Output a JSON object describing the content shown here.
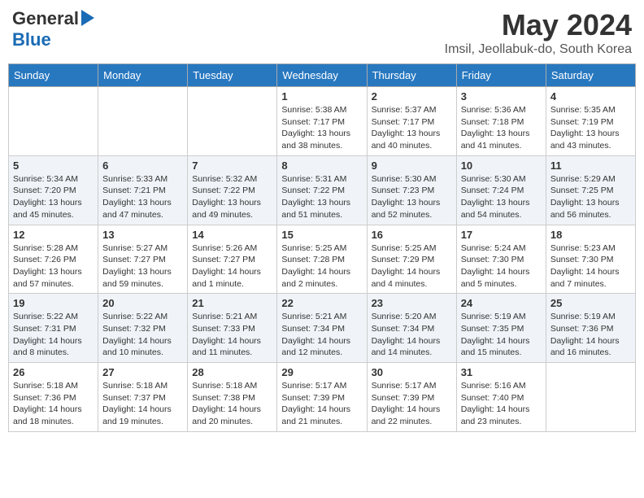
{
  "logo": {
    "general": "General",
    "blue": "Blue"
  },
  "header": {
    "month": "May 2024",
    "location": "Imsil, Jeollabuk-do, South Korea"
  },
  "days_of_week": [
    "Sunday",
    "Monday",
    "Tuesday",
    "Wednesday",
    "Thursday",
    "Friday",
    "Saturday"
  ],
  "weeks": [
    [
      {
        "day": "",
        "info": ""
      },
      {
        "day": "",
        "info": ""
      },
      {
        "day": "",
        "info": ""
      },
      {
        "day": "1",
        "info": "Sunrise: 5:38 AM\nSunset: 7:17 PM\nDaylight: 13 hours\nand 38 minutes."
      },
      {
        "day": "2",
        "info": "Sunrise: 5:37 AM\nSunset: 7:17 PM\nDaylight: 13 hours\nand 40 minutes."
      },
      {
        "day": "3",
        "info": "Sunrise: 5:36 AM\nSunset: 7:18 PM\nDaylight: 13 hours\nand 41 minutes."
      },
      {
        "day": "4",
        "info": "Sunrise: 5:35 AM\nSunset: 7:19 PM\nDaylight: 13 hours\nand 43 minutes."
      }
    ],
    [
      {
        "day": "5",
        "info": "Sunrise: 5:34 AM\nSunset: 7:20 PM\nDaylight: 13 hours\nand 45 minutes."
      },
      {
        "day": "6",
        "info": "Sunrise: 5:33 AM\nSunset: 7:21 PM\nDaylight: 13 hours\nand 47 minutes."
      },
      {
        "day": "7",
        "info": "Sunrise: 5:32 AM\nSunset: 7:22 PM\nDaylight: 13 hours\nand 49 minutes."
      },
      {
        "day": "8",
        "info": "Sunrise: 5:31 AM\nSunset: 7:22 PM\nDaylight: 13 hours\nand 51 minutes."
      },
      {
        "day": "9",
        "info": "Sunrise: 5:30 AM\nSunset: 7:23 PM\nDaylight: 13 hours\nand 52 minutes."
      },
      {
        "day": "10",
        "info": "Sunrise: 5:30 AM\nSunset: 7:24 PM\nDaylight: 13 hours\nand 54 minutes."
      },
      {
        "day": "11",
        "info": "Sunrise: 5:29 AM\nSunset: 7:25 PM\nDaylight: 13 hours\nand 56 minutes."
      }
    ],
    [
      {
        "day": "12",
        "info": "Sunrise: 5:28 AM\nSunset: 7:26 PM\nDaylight: 13 hours\nand 57 minutes."
      },
      {
        "day": "13",
        "info": "Sunrise: 5:27 AM\nSunset: 7:27 PM\nDaylight: 13 hours\nand 59 minutes."
      },
      {
        "day": "14",
        "info": "Sunrise: 5:26 AM\nSunset: 7:27 PM\nDaylight: 14 hours\nand 1 minute."
      },
      {
        "day": "15",
        "info": "Sunrise: 5:25 AM\nSunset: 7:28 PM\nDaylight: 14 hours\nand 2 minutes."
      },
      {
        "day": "16",
        "info": "Sunrise: 5:25 AM\nSunset: 7:29 PM\nDaylight: 14 hours\nand 4 minutes."
      },
      {
        "day": "17",
        "info": "Sunrise: 5:24 AM\nSunset: 7:30 PM\nDaylight: 14 hours\nand 5 minutes."
      },
      {
        "day": "18",
        "info": "Sunrise: 5:23 AM\nSunset: 7:30 PM\nDaylight: 14 hours\nand 7 minutes."
      }
    ],
    [
      {
        "day": "19",
        "info": "Sunrise: 5:22 AM\nSunset: 7:31 PM\nDaylight: 14 hours\nand 8 minutes."
      },
      {
        "day": "20",
        "info": "Sunrise: 5:22 AM\nSunset: 7:32 PM\nDaylight: 14 hours\nand 10 minutes."
      },
      {
        "day": "21",
        "info": "Sunrise: 5:21 AM\nSunset: 7:33 PM\nDaylight: 14 hours\nand 11 minutes."
      },
      {
        "day": "22",
        "info": "Sunrise: 5:21 AM\nSunset: 7:34 PM\nDaylight: 14 hours\nand 12 minutes."
      },
      {
        "day": "23",
        "info": "Sunrise: 5:20 AM\nSunset: 7:34 PM\nDaylight: 14 hours\nand 14 minutes."
      },
      {
        "day": "24",
        "info": "Sunrise: 5:19 AM\nSunset: 7:35 PM\nDaylight: 14 hours\nand 15 minutes."
      },
      {
        "day": "25",
        "info": "Sunrise: 5:19 AM\nSunset: 7:36 PM\nDaylight: 14 hours\nand 16 minutes."
      }
    ],
    [
      {
        "day": "26",
        "info": "Sunrise: 5:18 AM\nSunset: 7:36 PM\nDaylight: 14 hours\nand 18 minutes."
      },
      {
        "day": "27",
        "info": "Sunrise: 5:18 AM\nSunset: 7:37 PM\nDaylight: 14 hours\nand 19 minutes."
      },
      {
        "day": "28",
        "info": "Sunrise: 5:18 AM\nSunset: 7:38 PM\nDaylight: 14 hours\nand 20 minutes."
      },
      {
        "day": "29",
        "info": "Sunrise: 5:17 AM\nSunset: 7:39 PM\nDaylight: 14 hours\nand 21 minutes."
      },
      {
        "day": "30",
        "info": "Sunrise: 5:17 AM\nSunset: 7:39 PM\nDaylight: 14 hours\nand 22 minutes."
      },
      {
        "day": "31",
        "info": "Sunrise: 5:16 AM\nSunset: 7:40 PM\nDaylight: 14 hours\nand 23 minutes."
      },
      {
        "day": "",
        "info": ""
      }
    ]
  ]
}
